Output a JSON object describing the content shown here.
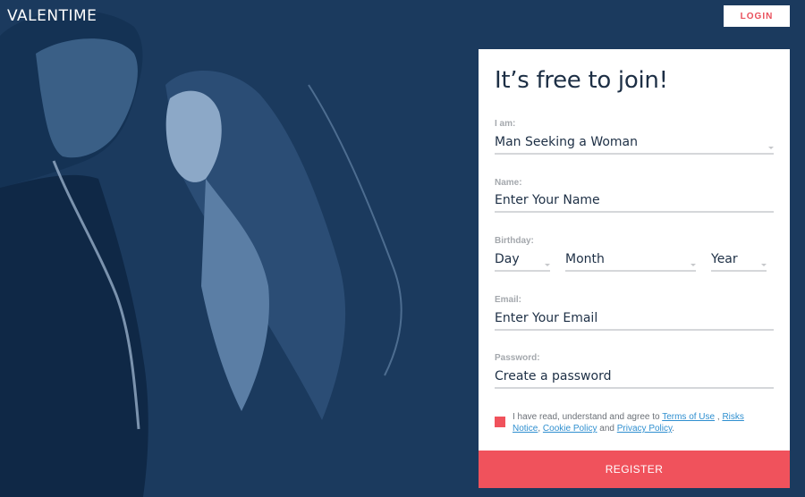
{
  "brand": {
    "logo_text": "VALENTIME"
  },
  "header": {
    "login_label": "LOGIN"
  },
  "form": {
    "title": "It’s free to join!",
    "iam": {
      "label": "I am:",
      "value": "Man Seeking a Woman"
    },
    "name": {
      "label": "Name:",
      "placeholder": "Enter Your Name"
    },
    "birthday": {
      "label": "Birthday:",
      "day": "Day",
      "month": "Month",
      "year": "Year"
    },
    "email": {
      "label": "Email:",
      "placeholder": "Enter Your Email"
    },
    "password": {
      "label": "Password:",
      "placeholder": "Create a password"
    },
    "terms": {
      "prefix": "I have read, understand and agree to",
      "terms_link": "Terms of Use",
      "separator1": ",",
      "risks_link": "Risks Notice",
      "separator2": ",",
      "cookie_link": "Cookie Policy",
      "and": "and",
      "privacy_link": "Privacy Policy",
      "suffix": "."
    },
    "register_label": "REGISTER"
  },
  "colors": {
    "background": "#1b3a5e",
    "accent": "#f0525c",
    "link": "#2f8fd0"
  }
}
